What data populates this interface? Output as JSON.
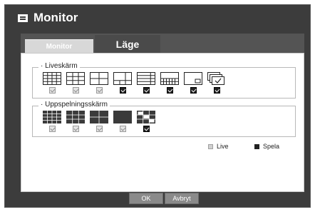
{
  "window": {
    "title": "Monitor",
    "icon": "monitor-icon"
  },
  "tabs": [
    {
      "label": "Monitor",
      "active": false
    },
    {
      "label": "Läge",
      "active": true
    }
  ],
  "live_screen": {
    "legend": "· Liveskärm",
    "layouts": [
      {
        "icon": "grid-16-icon",
        "checked": false
      },
      {
        "icon": "grid-9-icon",
        "checked": false
      },
      {
        "icon": "grid-4-icon",
        "checked": false
      },
      {
        "icon": "grid-6-icon",
        "checked": true
      },
      {
        "icon": "grid-8-icon",
        "checked": true
      },
      {
        "icon": "grid-13-icon",
        "checked": true
      },
      {
        "icon": "pip-icon",
        "checked": true
      },
      {
        "icon": "sequence-icon",
        "checked": true
      }
    ]
  },
  "playback_screen": {
    "legend": "· Uppspelningsskärm",
    "layouts": [
      {
        "icon": "grid-16-filled-icon",
        "checked": false
      },
      {
        "icon": "grid-9-filled-icon",
        "checked": false
      },
      {
        "icon": "grid-4-filled-icon",
        "checked": false
      },
      {
        "icon": "single-filled-icon",
        "checked": false
      },
      {
        "icon": "grid-6-mixed-icon",
        "checked": true
      }
    ]
  },
  "legend": {
    "live": "Live",
    "spela": "Spela"
  },
  "buttons": {
    "ok": "OK",
    "cancel": "Avbryt"
  },
  "colors": {
    "frame": "#3c3c3c",
    "tab_bar": "#545454",
    "active_tab": "#4a4a4a",
    "inactive_tab": "#d8d8d8",
    "button": "#8a8a8a"
  }
}
